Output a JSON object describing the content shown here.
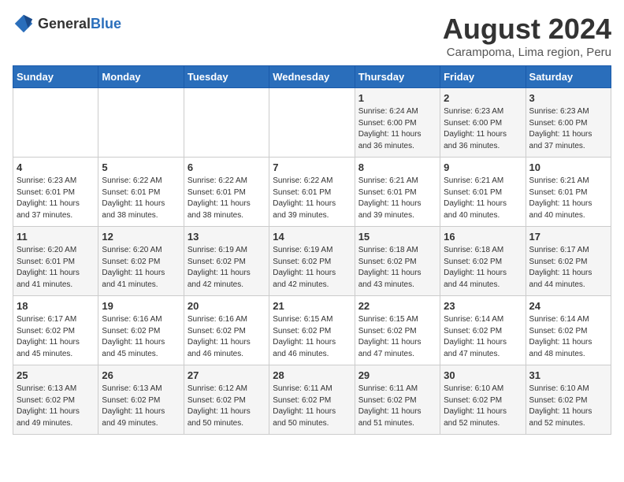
{
  "logo": {
    "general": "General",
    "blue": "Blue"
  },
  "title": "August 2024",
  "location": "Carampoma, Lima region, Peru",
  "days_header": [
    "Sunday",
    "Monday",
    "Tuesday",
    "Wednesday",
    "Thursday",
    "Friday",
    "Saturday"
  ],
  "weeks": [
    [
      {
        "day": "",
        "info": ""
      },
      {
        "day": "",
        "info": ""
      },
      {
        "day": "",
        "info": ""
      },
      {
        "day": "",
        "info": ""
      },
      {
        "day": "1",
        "info": "Sunrise: 6:24 AM\nSunset: 6:00 PM\nDaylight: 11 hours\nand 36 minutes."
      },
      {
        "day": "2",
        "info": "Sunrise: 6:23 AM\nSunset: 6:00 PM\nDaylight: 11 hours\nand 36 minutes."
      },
      {
        "day": "3",
        "info": "Sunrise: 6:23 AM\nSunset: 6:00 PM\nDaylight: 11 hours\nand 37 minutes."
      }
    ],
    [
      {
        "day": "4",
        "info": "Sunrise: 6:23 AM\nSunset: 6:01 PM\nDaylight: 11 hours\nand 37 minutes."
      },
      {
        "day": "5",
        "info": "Sunrise: 6:22 AM\nSunset: 6:01 PM\nDaylight: 11 hours\nand 38 minutes."
      },
      {
        "day": "6",
        "info": "Sunrise: 6:22 AM\nSunset: 6:01 PM\nDaylight: 11 hours\nand 38 minutes."
      },
      {
        "day": "7",
        "info": "Sunrise: 6:22 AM\nSunset: 6:01 PM\nDaylight: 11 hours\nand 39 minutes."
      },
      {
        "day": "8",
        "info": "Sunrise: 6:21 AM\nSunset: 6:01 PM\nDaylight: 11 hours\nand 39 minutes."
      },
      {
        "day": "9",
        "info": "Sunrise: 6:21 AM\nSunset: 6:01 PM\nDaylight: 11 hours\nand 40 minutes."
      },
      {
        "day": "10",
        "info": "Sunrise: 6:21 AM\nSunset: 6:01 PM\nDaylight: 11 hours\nand 40 minutes."
      }
    ],
    [
      {
        "day": "11",
        "info": "Sunrise: 6:20 AM\nSunset: 6:01 PM\nDaylight: 11 hours\nand 41 minutes."
      },
      {
        "day": "12",
        "info": "Sunrise: 6:20 AM\nSunset: 6:02 PM\nDaylight: 11 hours\nand 41 minutes."
      },
      {
        "day": "13",
        "info": "Sunrise: 6:19 AM\nSunset: 6:02 PM\nDaylight: 11 hours\nand 42 minutes."
      },
      {
        "day": "14",
        "info": "Sunrise: 6:19 AM\nSunset: 6:02 PM\nDaylight: 11 hours\nand 42 minutes."
      },
      {
        "day": "15",
        "info": "Sunrise: 6:18 AM\nSunset: 6:02 PM\nDaylight: 11 hours\nand 43 minutes."
      },
      {
        "day": "16",
        "info": "Sunrise: 6:18 AM\nSunset: 6:02 PM\nDaylight: 11 hours\nand 44 minutes."
      },
      {
        "day": "17",
        "info": "Sunrise: 6:17 AM\nSunset: 6:02 PM\nDaylight: 11 hours\nand 44 minutes."
      }
    ],
    [
      {
        "day": "18",
        "info": "Sunrise: 6:17 AM\nSunset: 6:02 PM\nDaylight: 11 hours\nand 45 minutes."
      },
      {
        "day": "19",
        "info": "Sunrise: 6:16 AM\nSunset: 6:02 PM\nDaylight: 11 hours\nand 45 minutes."
      },
      {
        "day": "20",
        "info": "Sunrise: 6:16 AM\nSunset: 6:02 PM\nDaylight: 11 hours\nand 46 minutes."
      },
      {
        "day": "21",
        "info": "Sunrise: 6:15 AM\nSunset: 6:02 PM\nDaylight: 11 hours\nand 46 minutes."
      },
      {
        "day": "22",
        "info": "Sunrise: 6:15 AM\nSunset: 6:02 PM\nDaylight: 11 hours\nand 47 minutes."
      },
      {
        "day": "23",
        "info": "Sunrise: 6:14 AM\nSunset: 6:02 PM\nDaylight: 11 hours\nand 47 minutes."
      },
      {
        "day": "24",
        "info": "Sunrise: 6:14 AM\nSunset: 6:02 PM\nDaylight: 11 hours\nand 48 minutes."
      }
    ],
    [
      {
        "day": "25",
        "info": "Sunrise: 6:13 AM\nSunset: 6:02 PM\nDaylight: 11 hours\nand 49 minutes."
      },
      {
        "day": "26",
        "info": "Sunrise: 6:13 AM\nSunset: 6:02 PM\nDaylight: 11 hours\nand 49 minutes."
      },
      {
        "day": "27",
        "info": "Sunrise: 6:12 AM\nSunset: 6:02 PM\nDaylight: 11 hours\nand 50 minutes."
      },
      {
        "day": "28",
        "info": "Sunrise: 6:11 AM\nSunset: 6:02 PM\nDaylight: 11 hours\nand 50 minutes."
      },
      {
        "day": "29",
        "info": "Sunrise: 6:11 AM\nSunset: 6:02 PM\nDaylight: 11 hours\nand 51 minutes."
      },
      {
        "day": "30",
        "info": "Sunrise: 6:10 AM\nSunset: 6:02 PM\nDaylight: 11 hours\nand 52 minutes."
      },
      {
        "day": "31",
        "info": "Sunrise: 6:10 AM\nSunset: 6:02 PM\nDaylight: 11 hours\nand 52 minutes."
      }
    ]
  ]
}
